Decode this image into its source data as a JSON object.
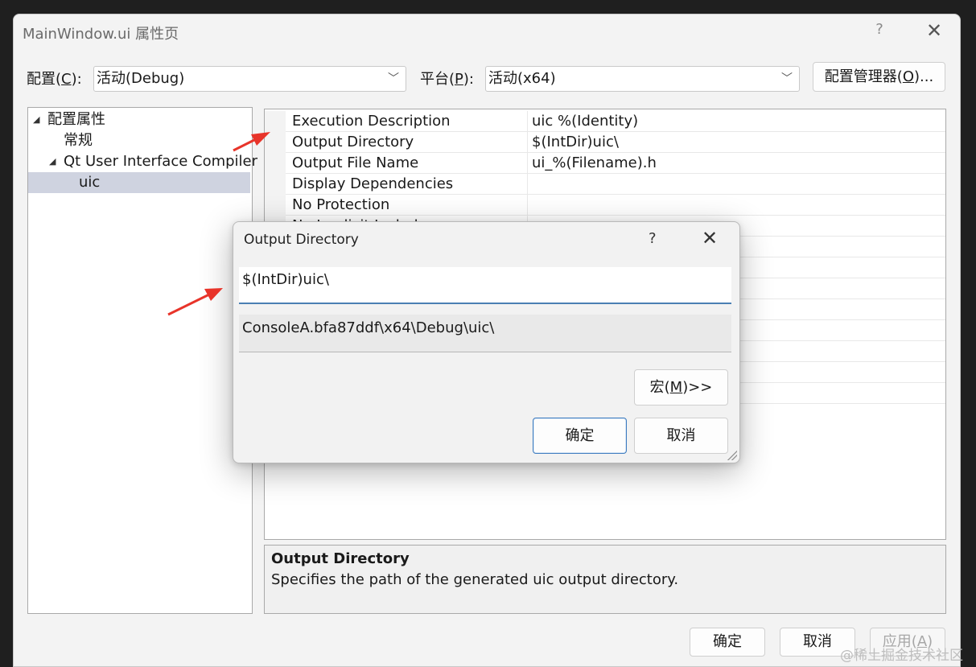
{
  "window": {
    "title": "MainWindow.ui 属性页",
    "help_glyph": "?",
    "close_glyph": "✕"
  },
  "toolbar": {
    "config_label_pre": "配置(",
    "config_label_key": "C",
    "config_label_post": "):",
    "config_value": "活动(Debug)",
    "platform_label_pre": "平台(",
    "platform_label_key": "P",
    "platform_label_post": "):",
    "platform_value": "活动(x64)",
    "manager_button_pre": "配置管理器(",
    "manager_button_key": "O",
    "manager_button_post": ")...",
    "dropdown_glyph": "﹀"
  },
  "tree": {
    "items": [
      {
        "label": "配置属性",
        "expanded": true
      },
      {
        "label": "常规"
      },
      {
        "label": "Qt User Interface Compiler",
        "expanded": true
      },
      {
        "label": "uic",
        "selected": true
      }
    ],
    "expand_glyph": "◢"
  },
  "properties": {
    "rows": [
      {
        "name": "Execution Description",
        "value": "uic %(Identity)"
      },
      {
        "name": "Output Directory",
        "value": "$(IntDir)uic\\"
      },
      {
        "name": "Output File Name",
        "value": "ui_%(Filename).h"
      },
      {
        "name": "Display Dependencies",
        "value": ""
      },
      {
        "name": "No Protection",
        "value": ""
      },
      {
        "name": "No Implicit Include",
        "value": ""
      }
    ]
  },
  "description": {
    "title": "Output Directory",
    "text": "Specifies the path of the generated uic output directory."
  },
  "footer": {
    "ok_label": "确定",
    "cancel_label": "取消",
    "apply_label_pre": "应用(",
    "apply_label_key": "A",
    "apply_label_post": ")"
  },
  "dialog": {
    "title": "Output Directory",
    "help_glyph": "?",
    "close_glyph": "✕",
    "input_value": "$(IntDir)uic\\",
    "evaluated_value": "ConsoleA.bfa87ddf\\x64\\Debug\\uic\\",
    "macro_pre": "宏(",
    "macro_key": "M",
    "macro_post": ")>>",
    "ok_label": "确定",
    "cancel_label": "取消"
  },
  "watermark": "@稀土掘金技术社区",
  "colors": {
    "accent": "#4a7fb3",
    "annotation_arrow": "#e8342a",
    "tree_selection": "#cfd3e0"
  }
}
